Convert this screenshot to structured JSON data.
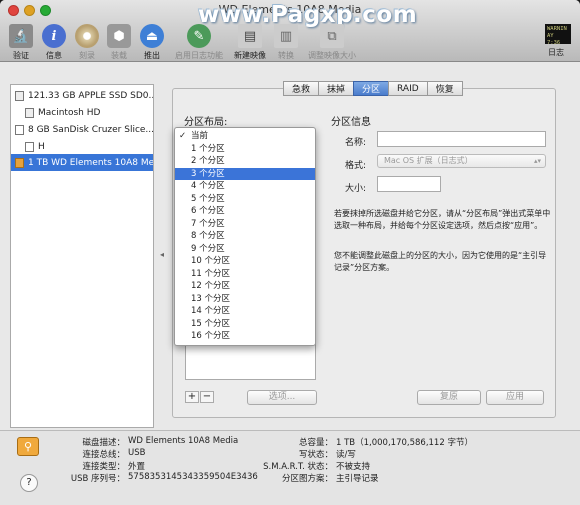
{
  "window": {
    "title": "WD Elements 10A8 Media",
    "watermark": "www.Pagxp.com"
  },
  "toolbar": {
    "verify": "验证",
    "info": "信息",
    "burn": "刻录",
    "mount": "装载",
    "eject": "推出",
    "journaling": "启用日志功能",
    "new_image": "新建映像",
    "convert": "转换",
    "resize_image": "调整映像大小",
    "log": "日志",
    "log_icon_text": "WARNIN\nAY 7:36"
  },
  "sidebar": {
    "items": [
      {
        "label": "121.33 GB APPLE SSD SD0..."
      },
      {
        "label": "Macintosh HD"
      },
      {
        "label": "8 GB SanDisk Cruzer Slice..."
      },
      {
        "label": "H"
      },
      {
        "label": "1 TB WD Elements 10A8 Media"
      }
    ]
  },
  "tabs": [
    "急救",
    "抹掉",
    "分区",
    "RAID",
    "恢复"
  ],
  "partition": {
    "layout_label": "分区布局:",
    "info_label": "分区信息",
    "name_label": "名称:",
    "format_label": "格式:",
    "format_value": "Mac OS 扩展（日志式）",
    "size_label": "大小:",
    "desc1": "若要抹掉所选磁盘并给它分区，请从“分区布局”弹出式菜单中选取一种布局，并给每个分区设定选项，然后点按“应用”。",
    "desc2": "您不能调整此磁盘上的分区的大小，因为它使用的是“主引导记录”分区方案。",
    "options_button": "选项...",
    "revert_button": "复原",
    "apply_button": "应用",
    "plus": "+",
    "minus": "−"
  },
  "menu": {
    "items": [
      "当前",
      "1 个分区",
      "2 个分区",
      "3 个分区",
      "4 个分区",
      "5 个分区",
      "6 个分区",
      "7 个分区",
      "8 个分区",
      "9 个分区",
      "10 个分区",
      "11 个分区",
      "12 个分区",
      "13 个分区",
      "14 个分区",
      "15 个分区",
      "16 个分区"
    ],
    "checked": "✓",
    "highlighted_index": 3
  },
  "info": {
    "disk_desc_k": "磁盘描述：",
    "disk_desc_v": "WD Elements 10A8 Media",
    "bus_k": "连接总线：",
    "bus_v": "USB",
    "type_k": "连接类型：",
    "type_v": "外置",
    "serial_k": "USB 序列号：",
    "serial_v": "575835314534335950​4E3436",
    "capacity_k": "总容量：",
    "capacity_v": "1 TB（1,000,170,586,112 字节）",
    "rw_k": "写状态：",
    "rw_v": "读/写",
    "smart_k": "S.M.A.R.T. 状态：",
    "smart_v": "不被支持",
    "scheme_k": "分区图方案：",
    "scheme_v": "主引导记录"
  },
  "colors": {
    "selection": "#3875d7",
    "menu_highlight": "#3b74d8",
    "tab_active": "#4a7ccc"
  }
}
